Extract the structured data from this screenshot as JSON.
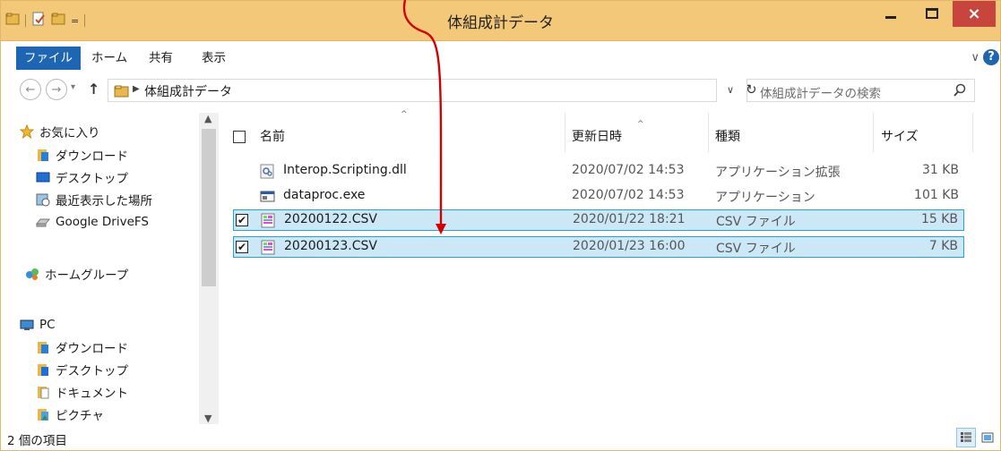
{
  "window": {
    "title": "体組成計データ",
    "qat_drop": "=",
    "close_glyph": "×"
  },
  "ribbon": {
    "tabs": [
      "ファイル",
      "ホーム",
      "共有",
      "表示"
    ],
    "expand_glyph": "∨",
    "help_glyph": "?"
  },
  "address": {
    "back_glyph": "←",
    "forward_glyph": "→",
    "history_glyph": "▾",
    "up_glyph": "↑",
    "arrow_glyph": "▶",
    "path": "体組成計データ",
    "drop_glyph": "∨",
    "refresh_glyph": "↻"
  },
  "search": {
    "placeholder": "体組成計データの検索"
  },
  "nav_scroll": {
    "up": "▲",
    "down": "▼"
  },
  "navigation": {
    "favorites_label": "お気に入り",
    "favorites": [
      "ダウンロード",
      "デスクトップ",
      "最近表示した場所",
      "Google DriveFS"
    ],
    "homegroup_label": "ホームグループ",
    "pc_label": "PC",
    "pc_items": [
      "ダウンロード",
      "デスクトップ",
      "ドキュメント",
      "ピクチャ"
    ]
  },
  "columns": {
    "name": "名前",
    "date": "更新日時",
    "type": "種類",
    "size": "サイズ",
    "sort_glyph": "^"
  },
  "files": [
    {
      "name": "Interop.Scripting.dll",
      "date": "2020/07/02 14:53",
      "type": "アプリケーション拡張",
      "size": "31 KB",
      "icon": "dll-icon",
      "selected": false
    },
    {
      "name": "dataproc.exe",
      "date": "2020/07/02 14:53",
      "type": "アプリケーション",
      "size": "101 KB",
      "icon": "exe-icon",
      "selected": false
    },
    {
      "name": "20200122.CSV",
      "date": "2020/01/22 18:21",
      "type": "CSV ファイル",
      "size": "15 KB",
      "icon": "csv-icon",
      "selected": true
    },
    {
      "name": "20200123.CSV",
      "date": "2020/01/23 16:00",
      "type": "CSV ファイル",
      "size": "7 KB",
      "icon": "csv-icon",
      "selected": true
    }
  ],
  "checkmark": "✔",
  "status": {
    "item_count": "2 個の項目"
  },
  "colors": {
    "titlebar": "#f3c979",
    "file_tab": "#1e65b3",
    "selection_bg": "#cce8f7",
    "selection_border": "#26a0da",
    "close_button": "#c7453c",
    "annotation_arrow": "#d40000"
  }
}
